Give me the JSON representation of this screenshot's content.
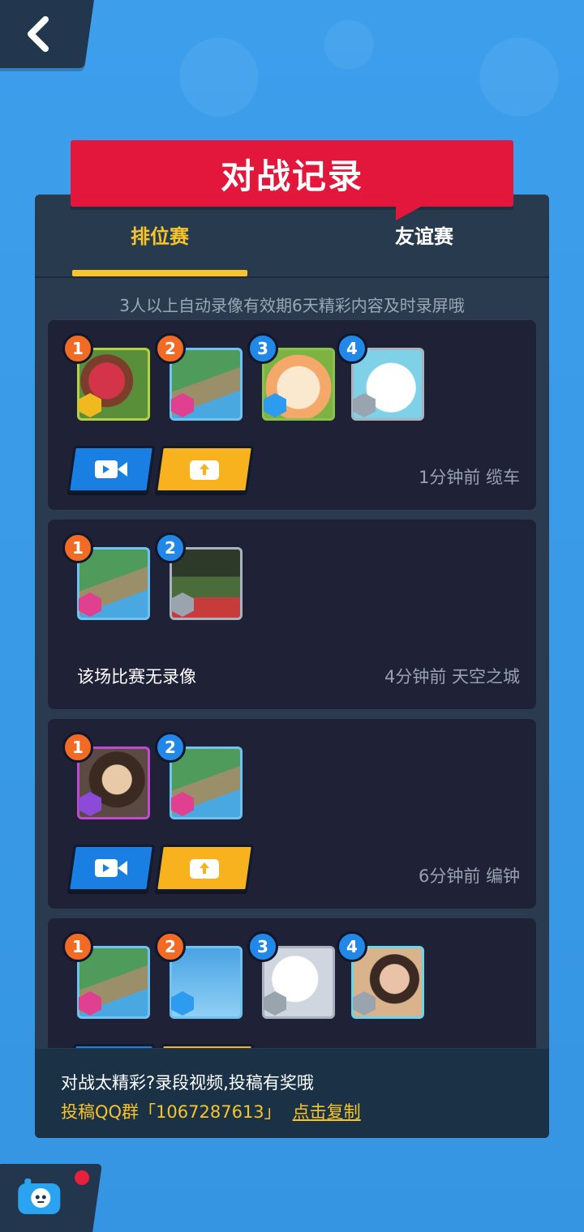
{
  "title": "对战记录",
  "tabs": {
    "ranked": "排位赛",
    "friendly": "友谊赛"
  },
  "notice": "3人以上自动录像有效期6天精彩内容及时录屏哦",
  "matches": [
    {
      "meta": "1分钟前 缆车",
      "players": [
        "1",
        "2",
        "3",
        "4"
      ],
      "has_replay": true
    },
    {
      "meta": "4分钟前 天空之城",
      "players": [
        "1",
        "2"
      ],
      "has_replay": false,
      "no_replay_text": "该场比赛无录像"
    },
    {
      "meta": "6分钟前 编钟",
      "players": [
        "1",
        "2"
      ],
      "has_replay": true
    },
    {
      "meta": "",
      "players": [
        "1",
        "2",
        "3",
        "4"
      ],
      "has_replay": true
    }
  ],
  "footer": {
    "line1": "对战太精彩?录段视频,投稿有奖哦",
    "line2": "投稿QQ群「1067287613」",
    "copy_link": "点击复制"
  },
  "colors": {
    "accent": "#f7c42a",
    "banner": "#e3173b",
    "video_button": "#1a7fe3",
    "share_button": "#f7b21e"
  },
  "icons": [
    "back-arrow-icon",
    "video-camera-icon",
    "share-upload-icon",
    "robot-icon"
  ]
}
